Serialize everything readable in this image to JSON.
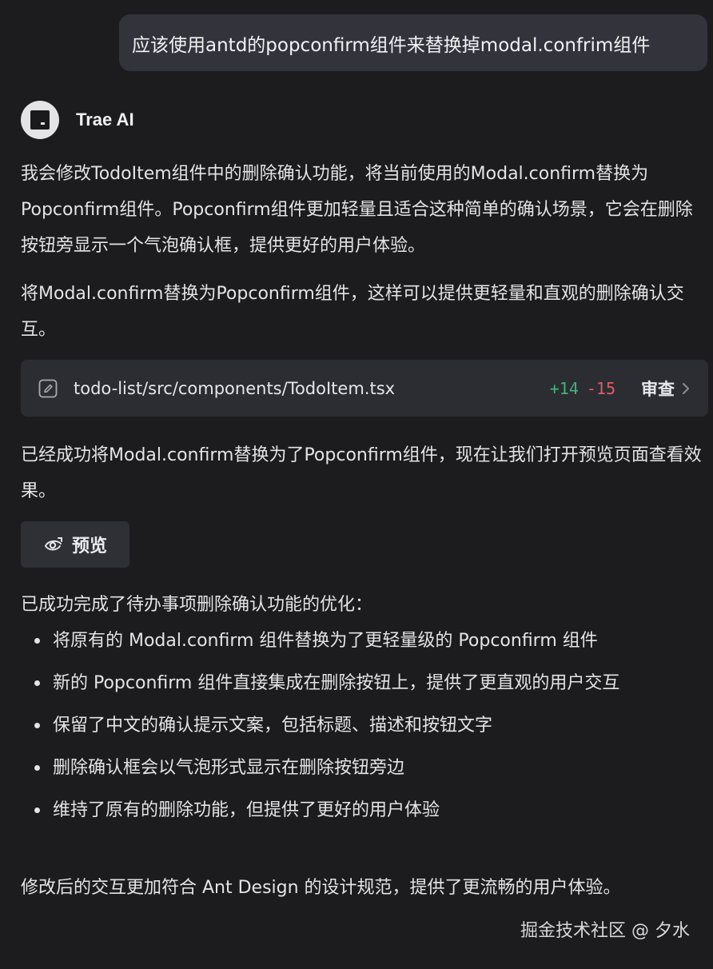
{
  "user_message": "应该使用antd的popconfirm组件来替换掉modal.confrim组件",
  "assistant": {
    "name": "Trae AI",
    "avatar_icon": "trae-logo-icon"
  },
  "paragraphs": {
    "intro": "我会修改TodoItem组件中的删除确认功能，将当前使用的Modal.confirm替换为Popconfirm组件。Popconfirm组件更加轻量且适合这种简单的确认场景，它会在删除按钮旁显示一个气泡确认框，提供更好的用户体验。",
    "plan": "将Modal.confirm替换为Popconfirm组件，这样可以提供更轻量和直观的删除确认交互。",
    "done": "已经成功将Modal.confirm替换为了Popconfirm组件，现在让我们打开预览页面查看效果。",
    "summary_title": "已成功完成了待办事项删除确认功能的优化：",
    "conclusion": "修改后的交互更加符合 Ant Design 的设计规范，提供了更流畅的用户体验。"
  },
  "file_change": {
    "icon": "edit-file-icon",
    "path": "todo-list/src/components/TodoItem.tsx",
    "additions": "+14",
    "deletions": "-15",
    "review_label": "审查",
    "colors": {
      "additions": "#3fb479",
      "deletions": "#e25d5d"
    }
  },
  "preview_button": {
    "icon": "preview-eye-icon",
    "label": "预览"
  },
  "summary_items": [
    "将原有的 Modal.confirm 组件替换为了更轻量级的 Popconfirm 组件",
    "新的 Popconfirm 组件直接集成在删除按钮上，提供了更直观的用户交互",
    "保留了中文的确认提示文案，包括标题、描述和按钮文字",
    "删除确认框会以气泡形式显示在删除按钮旁边",
    "维持了原有的删除功能，但提供了更好的用户体验"
  ],
  "watermark": "掘金技术社区 @ 夕水"
}
